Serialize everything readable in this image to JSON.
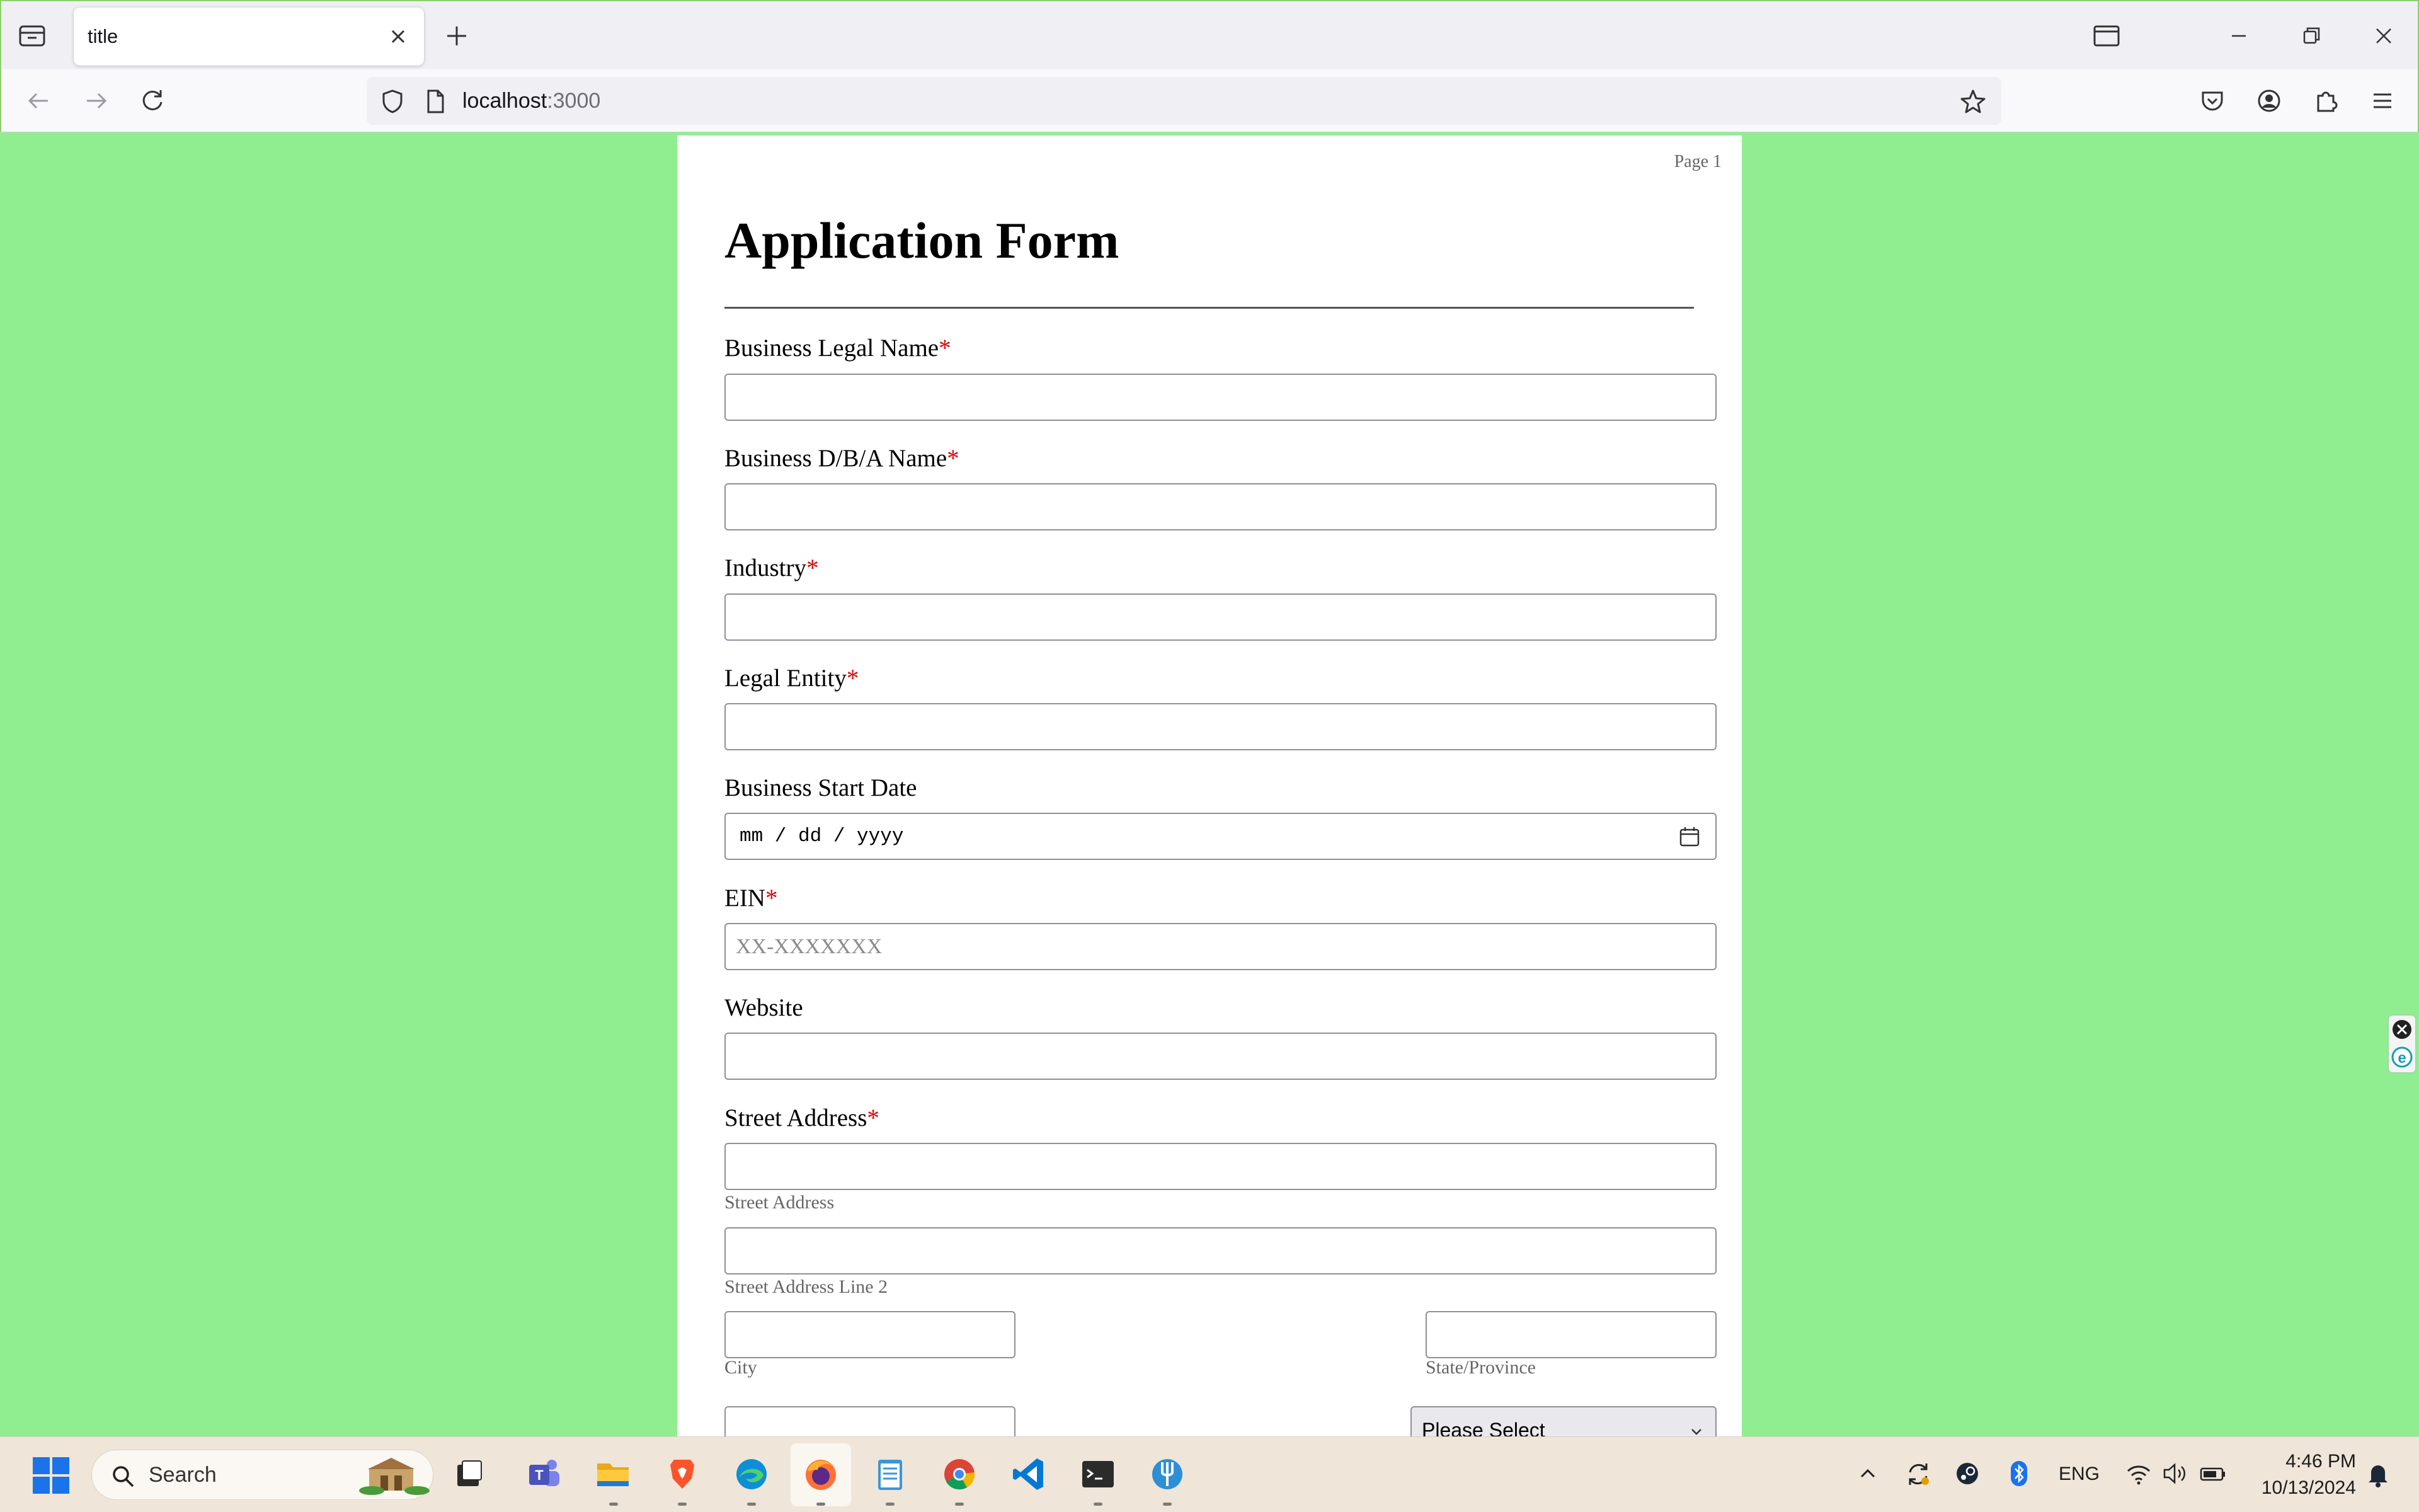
{
  "browser": {
    "tab": {
      "title": "title"
    },
    "url": {
      "host": "localhost",
      "port": ":3000"
    }
  },
  "page": {
    "page_number": "Page 1",
    "title": "Application Form",
    "fields": [
      {
        "label": "Business Legal Name",
        "required": "*"
      },
      {
        "label": "Business D/B/A Name",
        "required": "*"
      },
      {
        "label": "Industry",
        "required": "*"
      },
      {
        "label": "Legal Entity",
        "required": "*"
      },
      {
        "label": "Business Start Date",
        "value": "mm / dd / yyyy"
      },
      {
        "label": "EIN",
        "required": "*",
        "placeholder": "XX-XXXXXXX"
      },
      {
        "label": "Website"
      },
      {
        "label": "Street Address",
        "required": "*"
      }
    ],
    "address": {
      "street_sublabel": "Street Address",
      "line2_sublabel": "Street Address Line 2",
      "city_sublabel": "City",
      "state_sublabel": "State/Province",
      "country_select": "Please Select"
    }
  },
  "taskbar": {
    "search_label": "Search",
    "language": "ENG",
    "time": "4:46 PM",
    "date": "10/13/2024"
  },
  "colors": {
    "page_background": "#90ee90",
    "required_marker": "#e00000"
  }
}
